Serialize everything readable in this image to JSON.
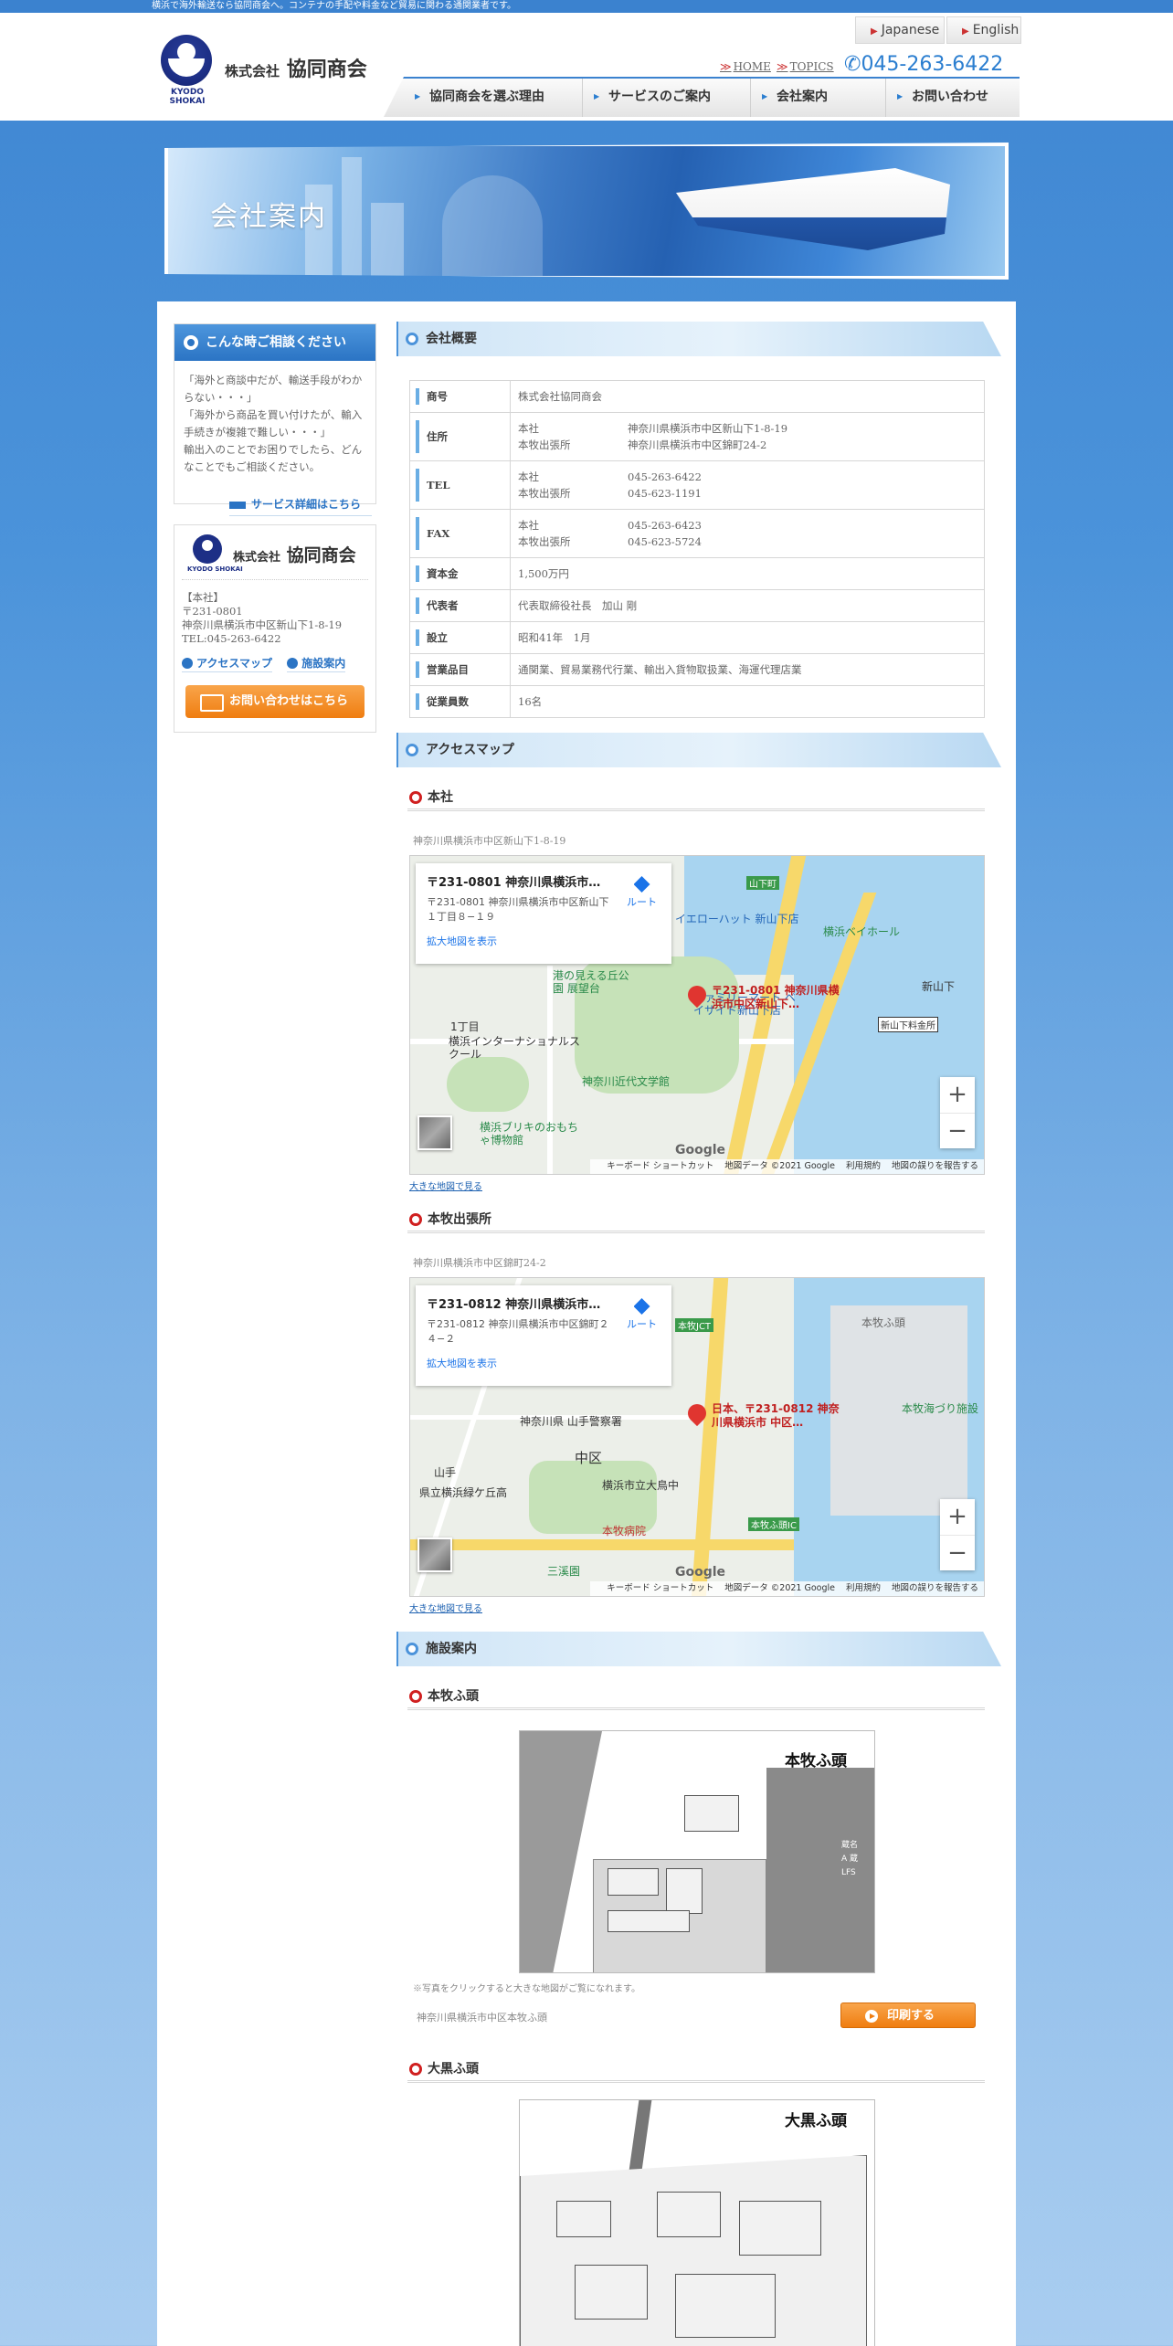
{
  "topbar": {
    "text": "横浜で海外輸送なら協同商会へ。コンテナの手配や料金など貿易に関わる通関業者です。"
  },
  "header": {
    "logo_roman": "KYODO SHOKAI",
    "logo_prefix": "株式会社",
    "logo_name": "協同商会",
    "lang_japanese": "Japanese",
    "lang_english": "English",
    "home": "HOME",
    "topics": "TOPICS",
    "phone": "045-263-6422",
    "nav": [
      "協同商会を選ぶ理由",
      "サービスのご案内",
      "会社案内",
      "お問い合わせ"
    ]
  },
  "banner": {
    "title": "会社案内"
  },
  "sidebar": {
    "consult_title": "こんな時ご相談ください",
    "consult_lines": [
      "「海外と商談中だが、輸送手段がわからない・・・」",
      "「海外から商品を買い付けたが、輸入手続きが複雑で難しい・・・」",
      "輸出入のことでお困りでしたら、どんなことでもご相談ください。"
    ],
    "consult_more": "サービス詳細はこちら",
    "company_roman": "KYODO SHOKAI",
    "company_prefix": "株式会社",
    "company_name": "協同商会",
    "info_lines": [
      "【本社】",
      "〒231-0801",
      "神奈川県横浜市中区新山下1-8-19",
      "TEL:045-263-6422"
    ],
    "access_link": "アクセスマップ",
    "facility_link": "施設案内",
    "contact_button": "お問い合わせはこちら"
  },
  "overview": {
    "title": "会社概要",
    "rows": [
      {
        "label": "商号",
        "lines": [
          [
            "株式会社協同商会",
            ""
          ]
        ]
      },
      {
        "label": "住所",
        "lines": [
          [
            "本社",
            "神奈川県横浜市中区新山下1-8-19"
          ],
          [
            "本牧出張所",
            "神奈川県横浜市中区錦町24-2"
          ]
        ]
      },
      {
        "label": "TEL",
        "lines": [
          [
            "本社",
            "045-263-6422"
          ],
          [
            "本牧出張所",
            "045-623-1191"
          ]
        ]
      },
      {
        "label": "FAX",
        "lines": [
          [
            "本社",
            "045-263-6423"
          ],
          [
            "本牧出張所",
            "045-623-5724"
          ]
        ]
      },
      {
        "label": "資本金",
        "lines": [
          [
            "1,500万円",
            ""
          ]
        ]
      },
      {
        "label": "代表者",
        "lines": [
          [
            "代表取締役社長　加山 剛",
            ""
          ]
        ]
      },
      {
        "label": "設立",
        "lines": [
          [
            "昭和41年　1月",
            ""
          ]
        ]
      },
      {
        "label": "営業品目",
        "lines": [
          [
            "通関業、貿易業務代行業、輸出入貨物取扱業、海運代理店業",
            ""
          ]
        ]
      },
      {
        "label": "従業員数",
        "lines": [
          [
            "16名",
            ""
          ]
        ]
      }
    ]
  },
  "access": {
    "title": "アクセスマップ",
    "honsha": {
      "title": "本社",
      "address": "神奈川県横浜市中区新山下1-8-19",
      "card_title": "〒231-0801 神奈川県横浜市中区新山下",
      "card_address": "〒231-0801 神奈川県横浜市中区新山下１丁目８−１９",
      "card_link": "拡大地図を表示",
      "route": "ルート",
      "pin_label": "〒231-0801 神奈川県横浜市中区新山下…",
      "places": [
        "イエローハット 新山下店",
        "ファミリーマート ベイサイド新山下店",
        "港の見える丘公園 展望台",
        "横浜インターナショナルスクール",
        "神奈川近代文学館",
        "横浜ブリキのおもちゃ博物館",
        "横浜ベイホール",
        "新山下",
        "新山下料金所",
        "1丁目",
        "山下町"
      ],
      "big_map": "大きな地図で見る"
    },
    "honmoku": {
      "title": "本牧出張所",
      "address": "神奈川県横浜市中区錦町24-2",
      "card_title": "〒231-0812 神奈川県横浜市中区錦町",
      "card_address": "〒231-0812 神奈川県横浜市中区錦町２４−２",
      "card_link": "拡大地図を表示",
      "route": "ルート",
      "pin_label": "日本、〒231-0812 神奈川県横浜市 中区…",
      "places": [
        "神奈川県 山手警察署",
        "中区",
        "横浜市立大鳥中",
        "本牧病院",
        "県立横浜緑ケ丘高",
        "山手",
        "三溪園",
        "本牧ふ頭",
        "本牧海づり施設",
        "本牧ふ頭IC",
        "本牧JCT"
      ],
      "big_map": "大きな地図で見る"
    },
    "attrib": [
      "キーボード ショートカット",
      "地図データ ©2021 Google",
      "利用規約",
      "地図の誤りを報告する"
    ],
    "google": "Google"
  },
  "facilities": {
    "title": "施設案内",
    "honmoku": {
      "title": "本牧ふ頭",
      "map_name": "本牧ふ頭",
      "legend": [
        "蔵名",
        "A 蔵",
        "LFS"
      ],
      "note": "※写真をクリックすると大きな地図がご覧になれます。",
      "address": "神奈川県横浜市中区本牧ふ頭",
      "print": "印刷する"
    },
    "daikoku": {
      "title": "大黒ふ頭",
      "map_name": "大黒ふ頭"
    }
  }
}
